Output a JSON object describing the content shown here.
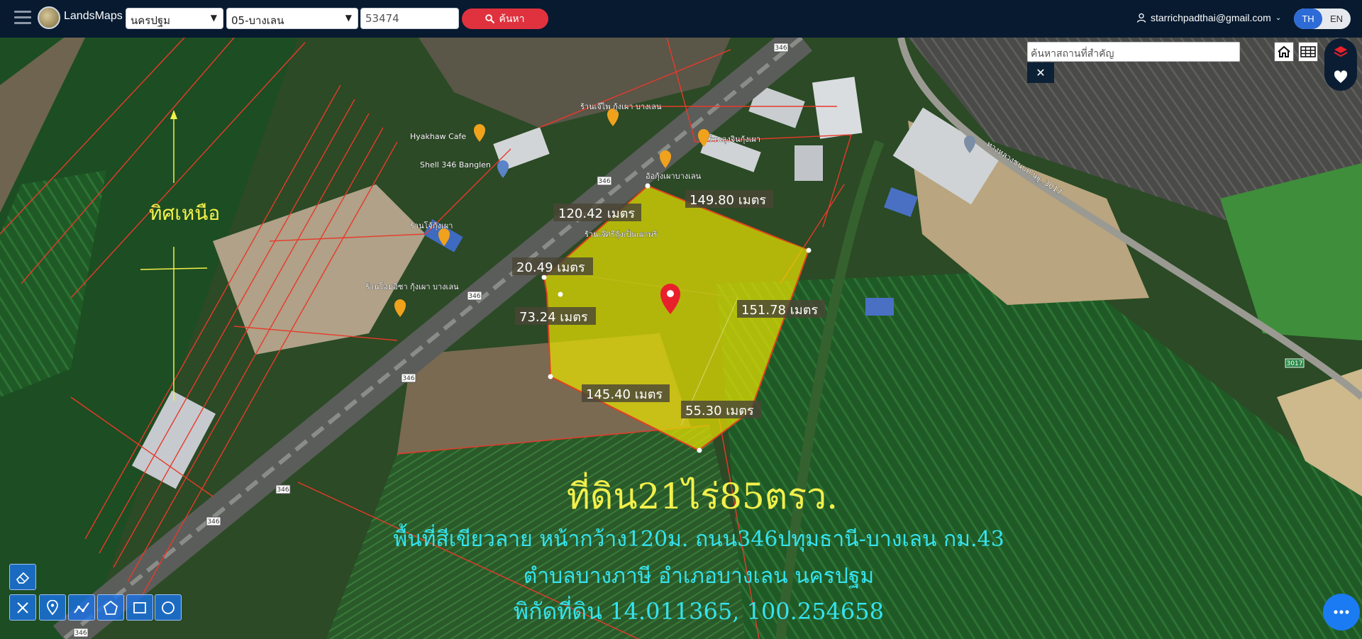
{
  "header": {
    "brand": "LandsMaps",
    "province_select": "นครปฐม",
    "district_select": "05-บางเลน",
    "parcel_input": "53474",
    "search_button": "ค้นหา",
    "user_email": "starrichpadthai@gmail.com",
    "lang_th": "TH",
    "lang_en": "EN"
  },
  "map_ui": {
    "place_search_placeholder": "ค้นหาสถานที่สำคัญ",
    "close_label": "✕"
  },
  "annotations": {
    "north_label": "ทิศเหนือ",
    "headline": "ที่ดิน21ไร่85ตรว.",
    "line1": "พื้นที่สีเขียวลาย หน้ากว้าง120ม. ถนน346ปทุมธานี-บางเลน กม.43",
    "line2": "ตำบลบางภาษี อำเภอบางเลน นครปฐม",
    "line3": "พิกัดที่ดิน 14.011365, 100.254658"
  },
  "measurements": [
    {
      "id": "m-120",
      "text": "120.42 เมตร"
    },
    {
      "id": "m-149",
      "text": "149.80 เมตร"
    },
    {
      "id": "m-20",
      "text": "20.49 เมตร"
    },
    {
      "id": "m-151",
      "text": "151.78 เมตร"
    },
    {
      "id": "m-73",
      "text": "73.24 เมตร"
    },
    {
      "id": "m-145",
      "text": "145.40 เมตร"
    },
    {
      "id": "m-55",
      "text": "55.30 เมตร"
    }
  ],
  "places": [
    {
      "name": "ร้านเจ๊ไพ กุ้งเผา บางเลน"
    },
    {
      "name": "Hyakhaw Cafe"
    },
    {
      "name": "ร้านลุงจินกุ้งเผา"
    },
    {
      "name": "Shell 346 Banglen"
    },
    {
      "name": "อ้อกุ้งเผาบางเลน"
    },
    {
      "name": "ร้านเจ๊ศรีกุ้งเป็นเผาพริ"
    },
    {
      "name": "ร้านโจ้กุ้งเผา"
    },
    {
      "name": "ร้านโอมอิซา กุ้งเผา บางเลน"
    },
    {
      "name": "ทางหลวงชนบท นฐ. 3017"
    }
  ],
  "road_labels": [
    "346",
    "346",
    "346",
    "346",
    "346",
    "346",
    "346",
    "3017"
  ],
  "colors": {
    "topbar": "#071a30",
    "parcel_fill": "#e6e000",
    "parcel_line": "#e04020",
    "annotation_yellow": "#f2f04a",
    "annotation_cyan": "#34e3ef",
    "search_red": "#e0323e",
    "lang_active": "#2d6bd6"
  }
}
